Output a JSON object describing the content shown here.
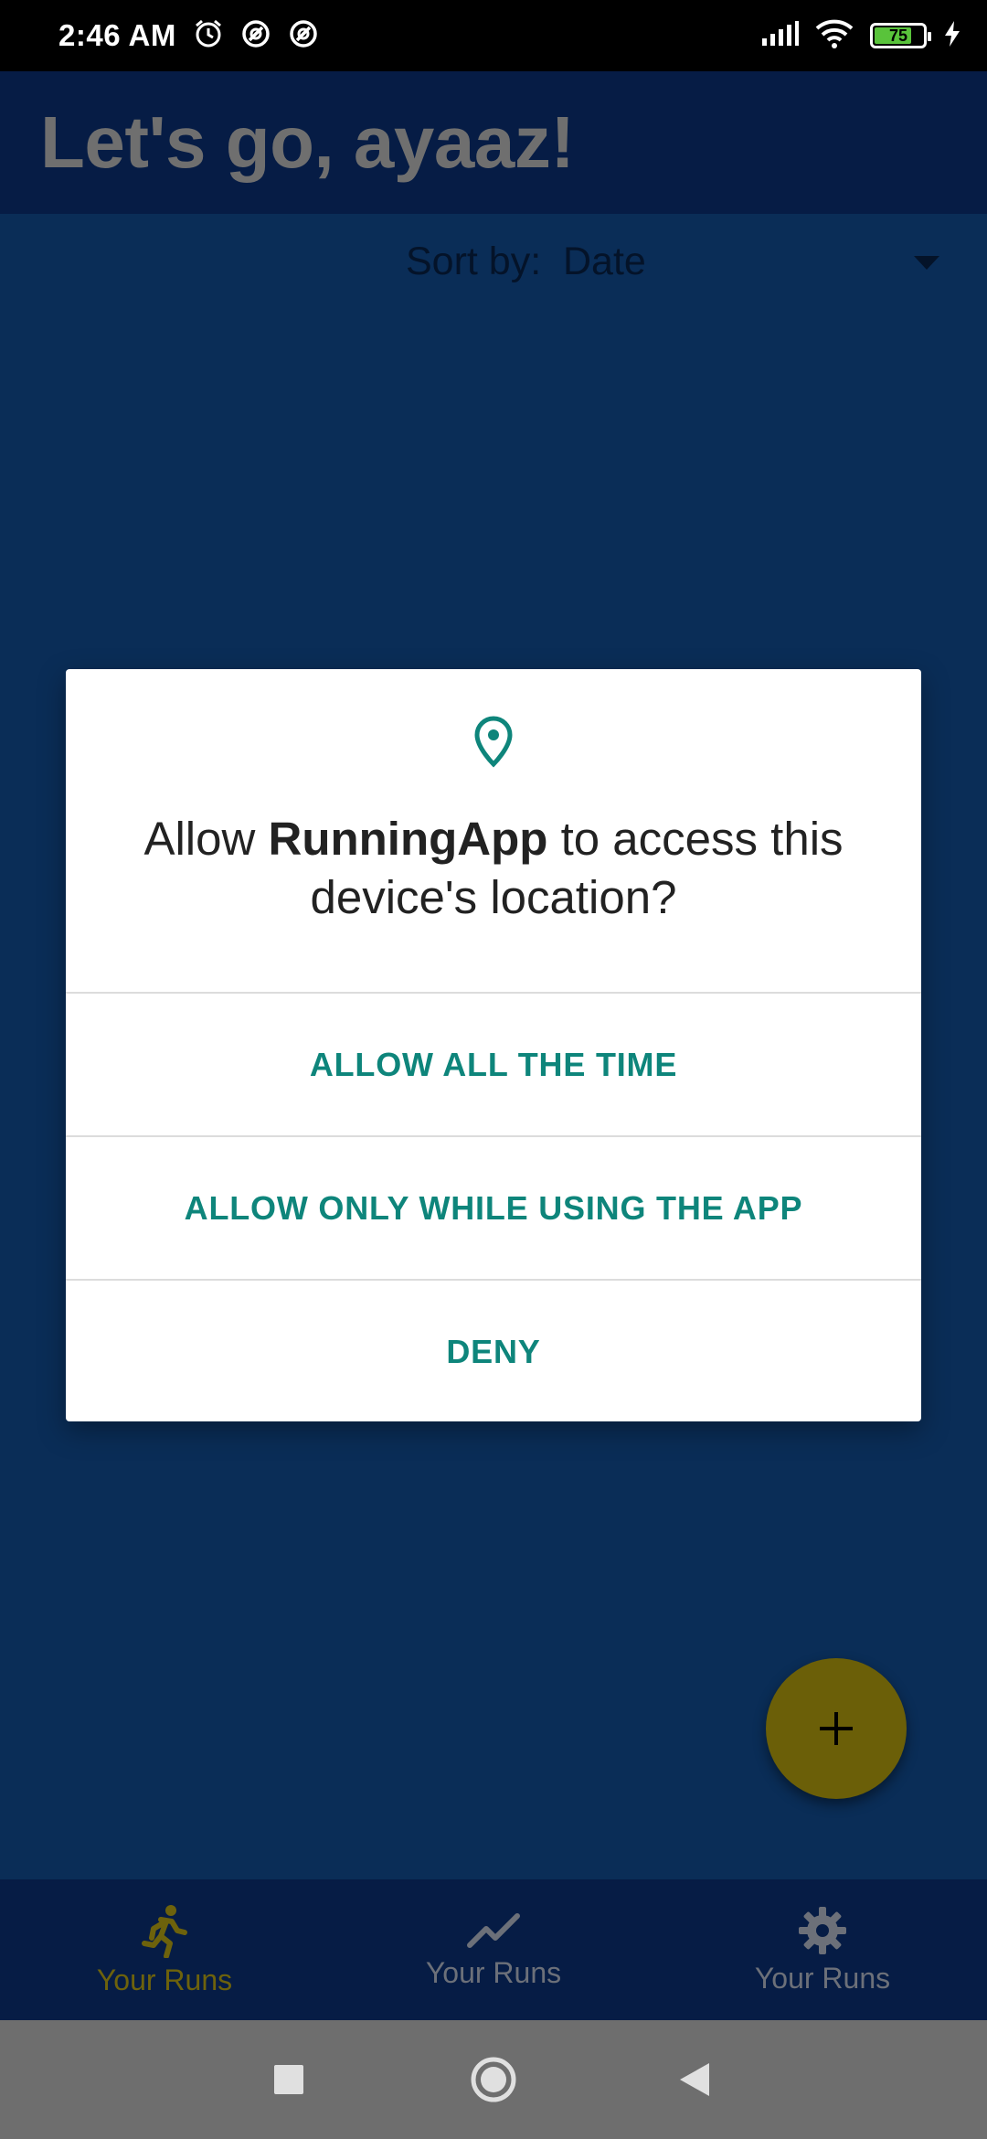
{
  "status_bar": {
    "time": "2:46 AM",
    "battery": "75",
    "icons": [
      "alarm-icon",
      "sync-icon",
      "sync-icon",
      "signal-icon",
      "wifi-icon",
      "battery-icon",
      "charging-icon"
    ]
  },
  "app_bar": {
    "title": "Let's go, ayaaz!"
  },
  "sort": {
    "label": "Sort by:",
    "value": "Date"
  },
  "dialog": {
    "title_prefix": "Allow ",
    "app_name": "RunningApp",
    "title_suffix": " to access this device's location?",
    "buttons": {
      "allow_all": "ALLOW ALL THE TIME",
      "allow_while_using": "ALLOW ONLY WHILE USING THE APP",
      "deny": "DENY"
    },
    "accent_color": "#0e857b"
  },
  "bottom_nav": {
    "items": [
      {
        "label": "Your Runs",
        "icon": "run-icon",
        "active": true
      },
      {
        "label": "Your Runs",
        "icon": "trend-icon",
        "active": false
      },
      {
        "label": "Your Runs",
        "icon": "gear-icon",
        "active": false
      }
    ]
  },
  "colors": {
    "background": "#0a2d57",
    "app_bar": "#061c45",
    "fab": "#6b5f08"
  }
}
